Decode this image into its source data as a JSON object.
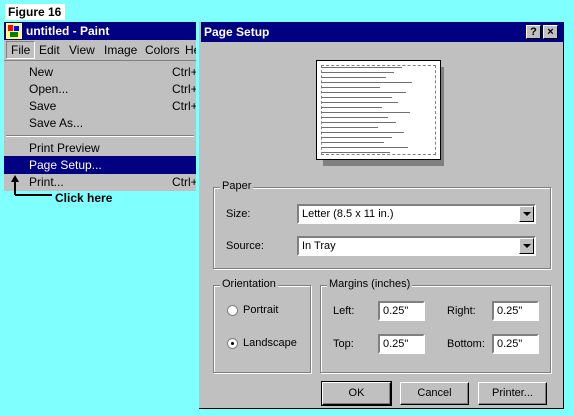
{
  "figure_label": "Figure 16",
  "paint": {
    "title": "untitled - Paint",
    "menu": [
      "File",
      "Edit",
      "View",
      "Image",
      "Colors",
      "He"
    ],
    "file_menu": [
      {
        "label": "New",
        "accel": "Ctrl+N"
      },
      {
        "label": "Open...",
        "accel": "Ctrl+O"
      },
      {
        "label": "Save",
        "accel": "Ctrl+S"
      },
      {
        "label": "Save As..."
      },
      {
        "label": "Print Preview"
      },
      {
        "label": "Page Setup..."
      },
      {
        "label": "Print...",
        "accel": "Ctrl+P"
      }
    ]
  },
  "annotation": "Click here",
  "dialog": {
    "title": "Page Setup",
    "help_glyph": "?",
    "close_glyph": "×",
    "paper": {
      "group": "Paper",
      "size_label": "Size:",
      "size_value": "Letter (8.5 x 11 in.)",
      "source_label": "Source:",
      "source_value": "In Tray"
    },
    "orientation": {
      "group": "Orientation",
      "portrait": "Portrait",
      "landscape": "Landscape",
      "selected": "landscape"
    },
    "margins": {
      "group": "Margins (inches)",
      "left_label": "Left:",
      "left": "0.25\"",
      "right_label": "Right:",
      "right": "0.25\"",
      "top_label": "Top:",
      "top": "0.25\"",
      "bottom_label": "Bottom:",
      "bottom": "0.25\""
    },
    "buttons": {
      "ok": "OK",
      "cancel": "Cancel",
      "printer": "Printer..."
    }
  },
  "colors": {
    "background": "#80ffff",
    "titlebar": "#000080",
    "face": "#c0c0c0"
  }
}
